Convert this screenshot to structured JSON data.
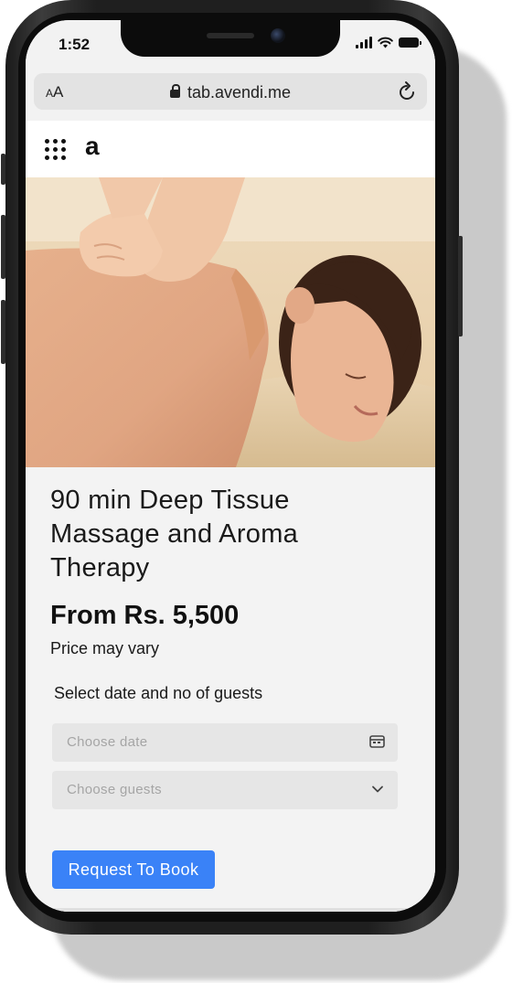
{
  "status_bar": {
    "time": "1:52"
  },
  "browser": {
    "text_size_small": "A",
    "text_size_large": "A",
    "url": "tab.avendi.me"
  },
  "app_header": {
    "logo_text": "a"
  },
  "hero_image": {
    "icon": "massage-photo"
  },
  "service": {
    "title": "90 min Deep Tissue Massage and Aroma Therapy",
    "price": "From Rs. 5,500",
    "price_note": "Price may vary"
  },
  "booking": {
    "section_label": "Select date and no of guests",
    "date_placeholder": "Choose date",
    "guests_placeholder": "Choose guests",
    "request_button": "Request To Book"
  },
  "colors": {
    "accent": "#3a82f7",
    "field_bg": "#e6e6e6",
    "page_bg": "#f3f3f3"
  }
}
